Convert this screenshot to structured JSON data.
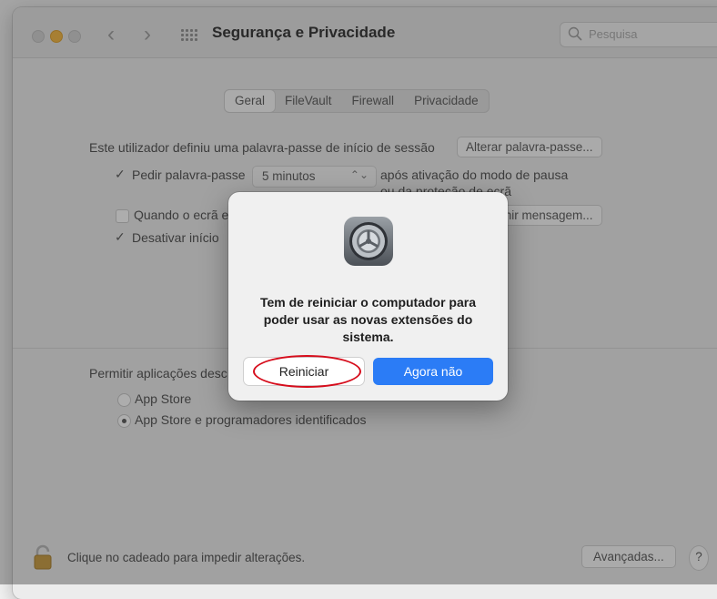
{
  "window": {
    "title": "Segurança e Privacidade",
    "search_placeholder": "Pesquisa"
  },
  "tabs": [
    "Geral",
    "FileVault",
    "Firewall",
    "Privacidade"
  ],
  "general": {
    "login_password_text": "Este utilizador definiu uma palavra-passe de início de sessão",
    "change_password_button": "Alterar palavra-passe...",
    "require_password_label": "Pedir palavra-passe",
    "require_password_value": "5 minutos",
    "after_sleep_line1": "após ativação do modo de pausa",
    "after_sleep_line2": "ou da proteção de ecrã",
    "when_screen_label": "Quando o ecrã e",
    "set_message_button": "finir mensagem...",
    "disable_login_label": "Desativar início"
  },
  "apps": {
    "allow_label": "Permitir aplicações desc",
    "options": [
      "App Store",
      "App Store e programadores identificados"
    ],
    "selected_index": 1
  },
  "footer": {
    "lock_text": "Clique no cadeado para impedir alterações.",
    "advanced_button": "Avançadas...",
    "help_button": "?"
  },
  "dialog": {
    "icon": "system-preferences-gear-icon",
    "message": "Tem de reiniciar o computador para poder usar as novas extensões do sistema.",
    "restart_button": "Reiniciar",
    "not_now_button": "Agora não"
  },
  "colors": {
    "primary_button": "#2b7cf6",
    "highlight_ring": "#d60d1c",
    "traffic_close": "#d0d0d0",
    "traffic_minimize": "#f5b53a",
    "traffic_zoom": "#d0d0d0"
  }
}
